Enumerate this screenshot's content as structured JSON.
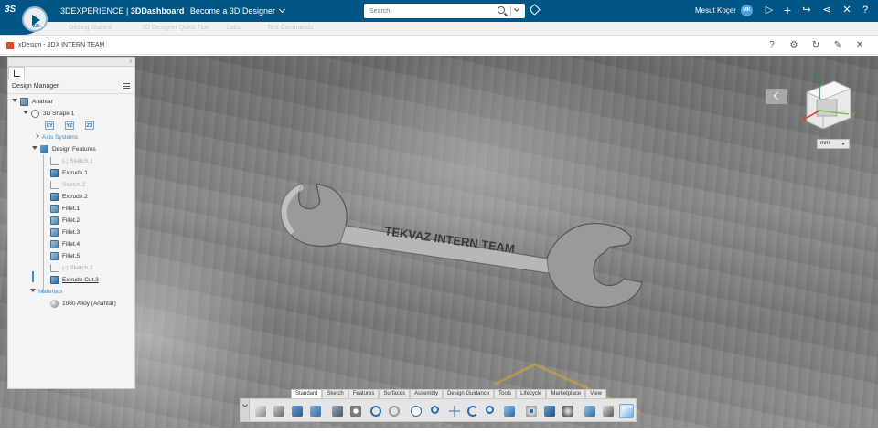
{
  "topbar": {
    "brand_light": "3DEXPERIENCE",
    "brand_sep": " | ",
    "brand_bold": "3DDashboard",
    "dashboard_name": "Become a 3D Designer",
    "search_placeholder": "Search",
    "user_name": "Mesut Koçer",
    "user_initials": "MK",
    "compass_labels": {
      "ds": "3S",
      "v": "V.R"
    }
  },
  "tabs_strip": [
    "Getting Started",
    "3D Designer Quick Tips",
    "Labs",
    "Test Commands"
  ],
  "widget": {
    "title": "xDesign - 3DX INTERN TEAM"
  },
  "panel": {
    "header": "Design Manager",
    "tree": [
      {
        "label": "Anahtar",
        "icon": "part-icon"
      },
      {
        "label": "3D Shape 1",
        "icon": "shape-icon"
      },
      {
        "label": "Axis Systems",
        "icon": "",
        "style": "link"
      },
      {
        "label": "Design Features",
        "icon": "feature-icon"
      },
      {
        "label": "(-) Sketch.1",
        "icon": "sketch-icon",
        "style": "dim"
      },
      {
        "label": "Extrude.1",
        "icon": "extrude-icon"
      },
      {
        "label": "Sketch.2",
        "icon": "sketch-icon",
        "style": "dim"
      },
      {
        "label": "Extrude.2",
        "icon": "extrude-icon"
      },
      {
        "label": "Fillet.1",
        "icon": "fillet-icon"
      },
      {
        "label": "Fillet.2",
        "icon": "fillet-icon"
      },
      {
        "label": "Fillet.3",
        "icon": "fillet-icon"
      },
      {
        "label": "Fillet.4",
        "icon": "fillet-icon"
      },
      {
        "label": "Fillet.5",
        "icon": "fillet-icon"
      },
      {
        "label": "(-) Sketch.3",
        "icon": "sketch-icon",
        "style": "dim"
      },
      {
        "label": "Extrude Cut.3",
        "icon": "extrude-icon",
        "style": "under"
      },
      {
        "label": "Materials",
        "icon": "",
        "style": "link"
      },
      {
        "label": "1060 Alloy (Anahtar)",
        "icon": "material-icon"
      }
    ],
    "axis_planes": [
      "XY",
      "YZ",
      "ZX"
    ]
  },
  "viewport": {
    "wrench_text": "TEKVAZ INTERN TEAM",
    "compass_axes": {
      "x": "X",
      "y": "Y",
      "z": "Z"
    },
    "unit": "mm"
  },
  "action_bar": {
    "tabs": [
      "Standard",
      "Sketch",
      "Features",
      "Surfaces",
      "Assembly",
      "Design Guidance",
      "Tools",
      "Lifecycle",
      "Marketplace",
      "View"
    ],
    "active_tab": "Standard"
  },
  "colors": {
    "topbar": "#005686",
    "accent": "#3a8fd0"
  }
}
